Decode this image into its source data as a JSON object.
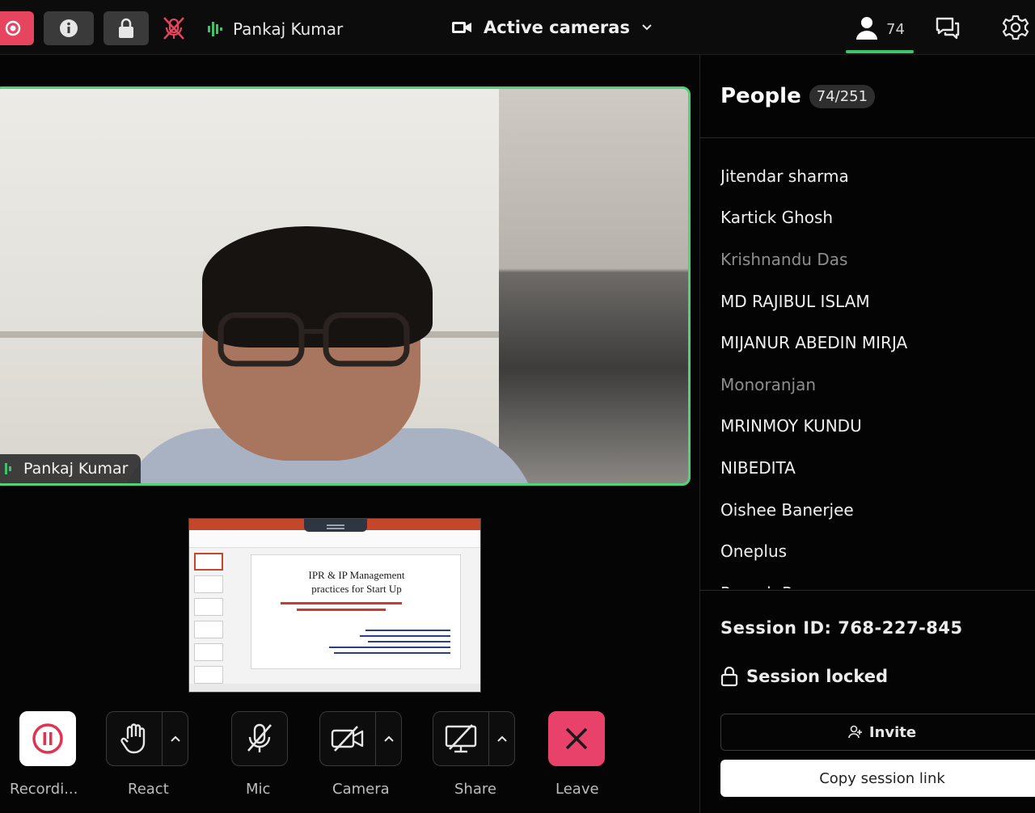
{
  "topbar": {
    "speaker_name": "Pankaj Kumar",
    "camera_view_label": "Active cameras",
    "people_count": "74"
  },
  "main_video": {
    "participant_name": "Pankaj Kumar"
  },
  "shared_slide": {
    "title_line1": "IPR & IP Management",
    "title_line2": "practices for Start Up"
  },
  "controls": {
    "recording_label": "Recordi...",
    "react_label": "React",
    "mic_label": "Mic",
    "camera_label": "Camera",
    "share_label": "Share",
    "leave_label": "Leave"
  },
  "sidebar": {
    "title": "People",
    "badge": "74/251",
    "people": [
      {
        "name": "Jitendar sharma",
        "dim": false
      },
      {
        "name": "Kartick Ghosh",
        "dim": false
      },
      {
        "name": "Krishnandu Das",
        "dim": true
      },
      {
        "name": "MD RAJIBUL ISLAM",
        "dim": false
      },
      {
        "name": "MIJANUR ABEDIN MIRJA",
        "dim": false
      },
      {
        "name": "Monoranjan",
        "dim": true
      },
      {
        "name": "MRINMOY KUNDU",
        "dim": false
      },
      {
        "name": "NIBEDITA",
        "dim": false
      },
      {
        "name": "Oishee Banerjee",
        "dim": false
      },
      {
        "name": "Oneplus",
        "dim": false
      },
      {
        "name": "Pranab Ray",
        "dim": false
      }
    ],
    "session_id": "Session ID: 768-227-845",
    "session_locked": "Session locked",
    "invite_label": "Invite",
    "copy_link_label": "Copy session link"
  },
  "colors": {
    "accent_green": "#4fd37a",
    "record_red": "#e6445f",
    "leave_red": "#e8426a"
  }
}
